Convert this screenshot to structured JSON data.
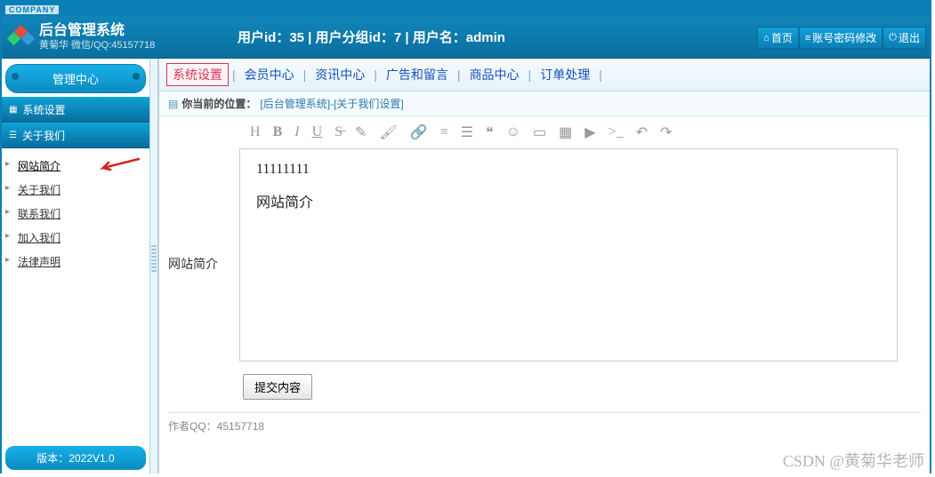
{
  "company_tag": "COMPANY",
  "header": {
    "title": "后台管理系统",
    "subtitle": "黄菊华 微信/QQ:45157718",
    "user_info": "用户id：35 | 用户分组id：7 | 用户名：admin",
    "home_btn": "首页",
    "pwd_btn": "账号密码修改",
    "logout_btn": "退出"
  },
  "sidebar": {
    "head": "管理中心",
    "cat1": "系统设置",
    "cat2": "关于我们",
    "items": [
      "网站简介",
      "关于我们",
      "联系我们",
      "加入我们",
      "法律声明"
    ],
    "version": "版本：2022V1.0"
  },
  "topnav": {
    "items": [
      "系统设置",
      "会员中心",
      "资讯中心",
      "广告和留言",
      "商品中心",
      "订单处理"
    ]
  },
  "breadcrumb": {
    "label": "你当前的位置：",
    "path": "[后台管理系统]-[关于我们设置]"
  },
  "form": {
    "label": "网站简介",
    "content_line1": "11111111",
    "content_line2": "网站简介",
    "submit": "提交内容"
  },
  "footer_note": "作者QQ：45157718",
  "watermark": "CSDN @黄菊华老师"
}
